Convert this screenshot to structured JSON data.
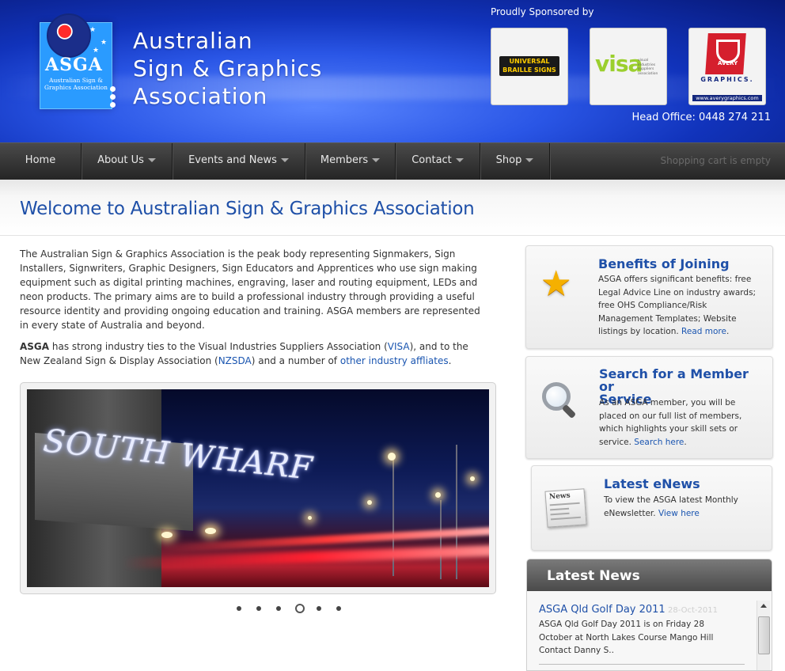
{
  "header": {
    "logo_abbr": "ASGA",
    "logo_text": "Australian Sign & Graphics Association",
    "site_title_line1": "Australian",
    "site_title_line2": "Sign & Graphics",
    "site_title_line3": "Association",
    "sponsor_label": "Proudly Sponsored by",
    "sponsors": [
      {
        "name": "UNIVERSAL BRAILLE SIGNS"
      },
      {
        "name": "visa",
        "sub": "visual industries suppliers association"
      },
      {
        "name": "AVERY",
        "sub": "GRAPHICS.",
        "url": "www.averygraphics.com"
      }
    ],
    "head_office": "Head Office: 0448 274 211"
  },
  "nav": {
    "items": [
      {
        "label": "Home"
      },
      {
        "label": "About Us"
      },
      {
        "label": "Events and News"
      },
      {
        "label": "Members"
      },
      {
        "label": "Contact"
      },
      {
        "label": "Shop"
      }
    ],
    "cart": "Shopping cart is empty"
  },
  "page": {
    "title": "Welcome to Australian Sign & Graphics Association",
    "intro_p1": "The Australian Sign & Graphics Association is the peak body representing Signmakers, Sign Installers, Signwriters, Graphic Designers, Sign Educators and Apprentices who use sign making equipment such as digital printing machines, engraving, laser and routing equipment, LEDs and neon products. The primary aims are to build a professional industry through providing a useful resource identity and providing ongoing education and training. ASGA members are represented in every state of Australia and beyond.",
    "intro_p2_bold": "ASGA",
    "intro_p2_a": " has strong industry ties to the Visual Industries Suppliers Association (",
    "intro_p2_link1": "VISA",
    "intro_p2_b": "), and to the New Zealand Sign & Display Association (",
    "intro_p2_link2": "NZSDA",
    "intro_p2_c": ") and a number of ",
    "intro_p2_link3": "other industry affliates",
    "intro_p2_d": ".",
    "slider_sign": "SOUTH WHARF"
  },
  "sidebar": {
    "benefits": {
      "title": "Benefits of Joining",
      "text": "ASGA offers significant benefits: free Legal Advice Line on industry awards; free OHS Compliance/Risk Management Templates; Website listings by location.",
      "link": "Read more",
      "suffix": "."
    },
    "search": {
      "title_line1": "Search for a Member or",
      "title_line2": "Service",
      "text": "As an ASGA member, you will be placed on our full list of members, which highlights your skill sets or service.",
      "link": "Search here",
      "suffix": "."
    },
    "enews": {
      "title": "Latest eNews",
      "icon_label": "News",
      "text": "To view the ASGA latest Monthly eNewsletter. ",
      "link": "View here"
    },
    "latest_news": {
      "heading": "Latest News",
      "item_title": "ASGA Qld Golf Day 2011",
      "item_date": "28-Oct-2011",
      "item_body": "ASGA Qld Golf Day 2011 is on Friday 28 October at North Lakes Course Mango Hill Contact Danny S.."
    }
  }
}
